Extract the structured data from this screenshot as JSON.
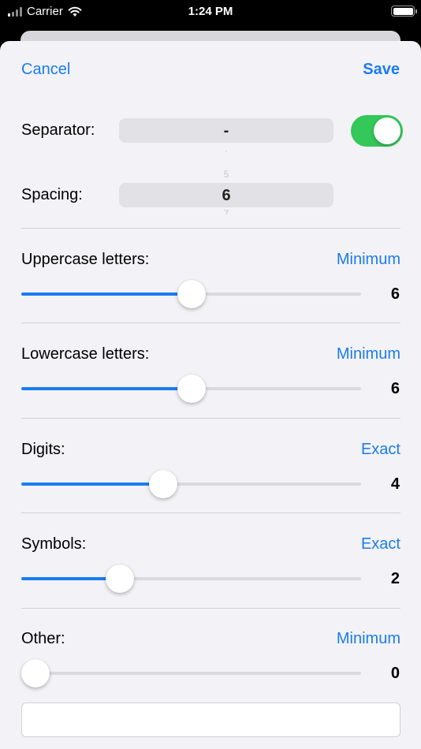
{
  "status_bar": {
    "carrier": "Carrier",
    "time": "1:24 PM"
  },
  "nav": {
    "cancel_label": "Cancel",
    "save_label": "Save"
  },
  "separator": {
    "label": "Separator:",
    "value": "-",
    "enabled": true
  },
  "spacing": {
    "label": "Spacing:",
    "value": "6",
    "prev_value": "5",
    "next_value": "7"
  },
  "sliders": [
    {
      "label": "Uppercase letters:",
      "mode": "Minimum",
      "value": "6",
      "fraction": 0.5
    },
    {
      "label": "Lowercase letters:",
      "mode": "Minimum",
      "value": "6",
      "fraction": 0.5
    },
    {
      "label": "Digits:",
      "mode": "Exact",
      "value": "4",
      "fraction": 0.41
    },
    {
      "label": "Symbols:",
      "mode": "Exact",
      "value": "2",
      "fraction": 0.27
    },
    {
      "label": "Other:",
      "mode": "Minimum",
      "value": "0",
      "fraction": 0.0
    }
  ],
  "colors": {
    "accent": "#1a7cf0",
    "toggle_on": "#34c759",
    "background": "#f2f2f7"
  }
}
